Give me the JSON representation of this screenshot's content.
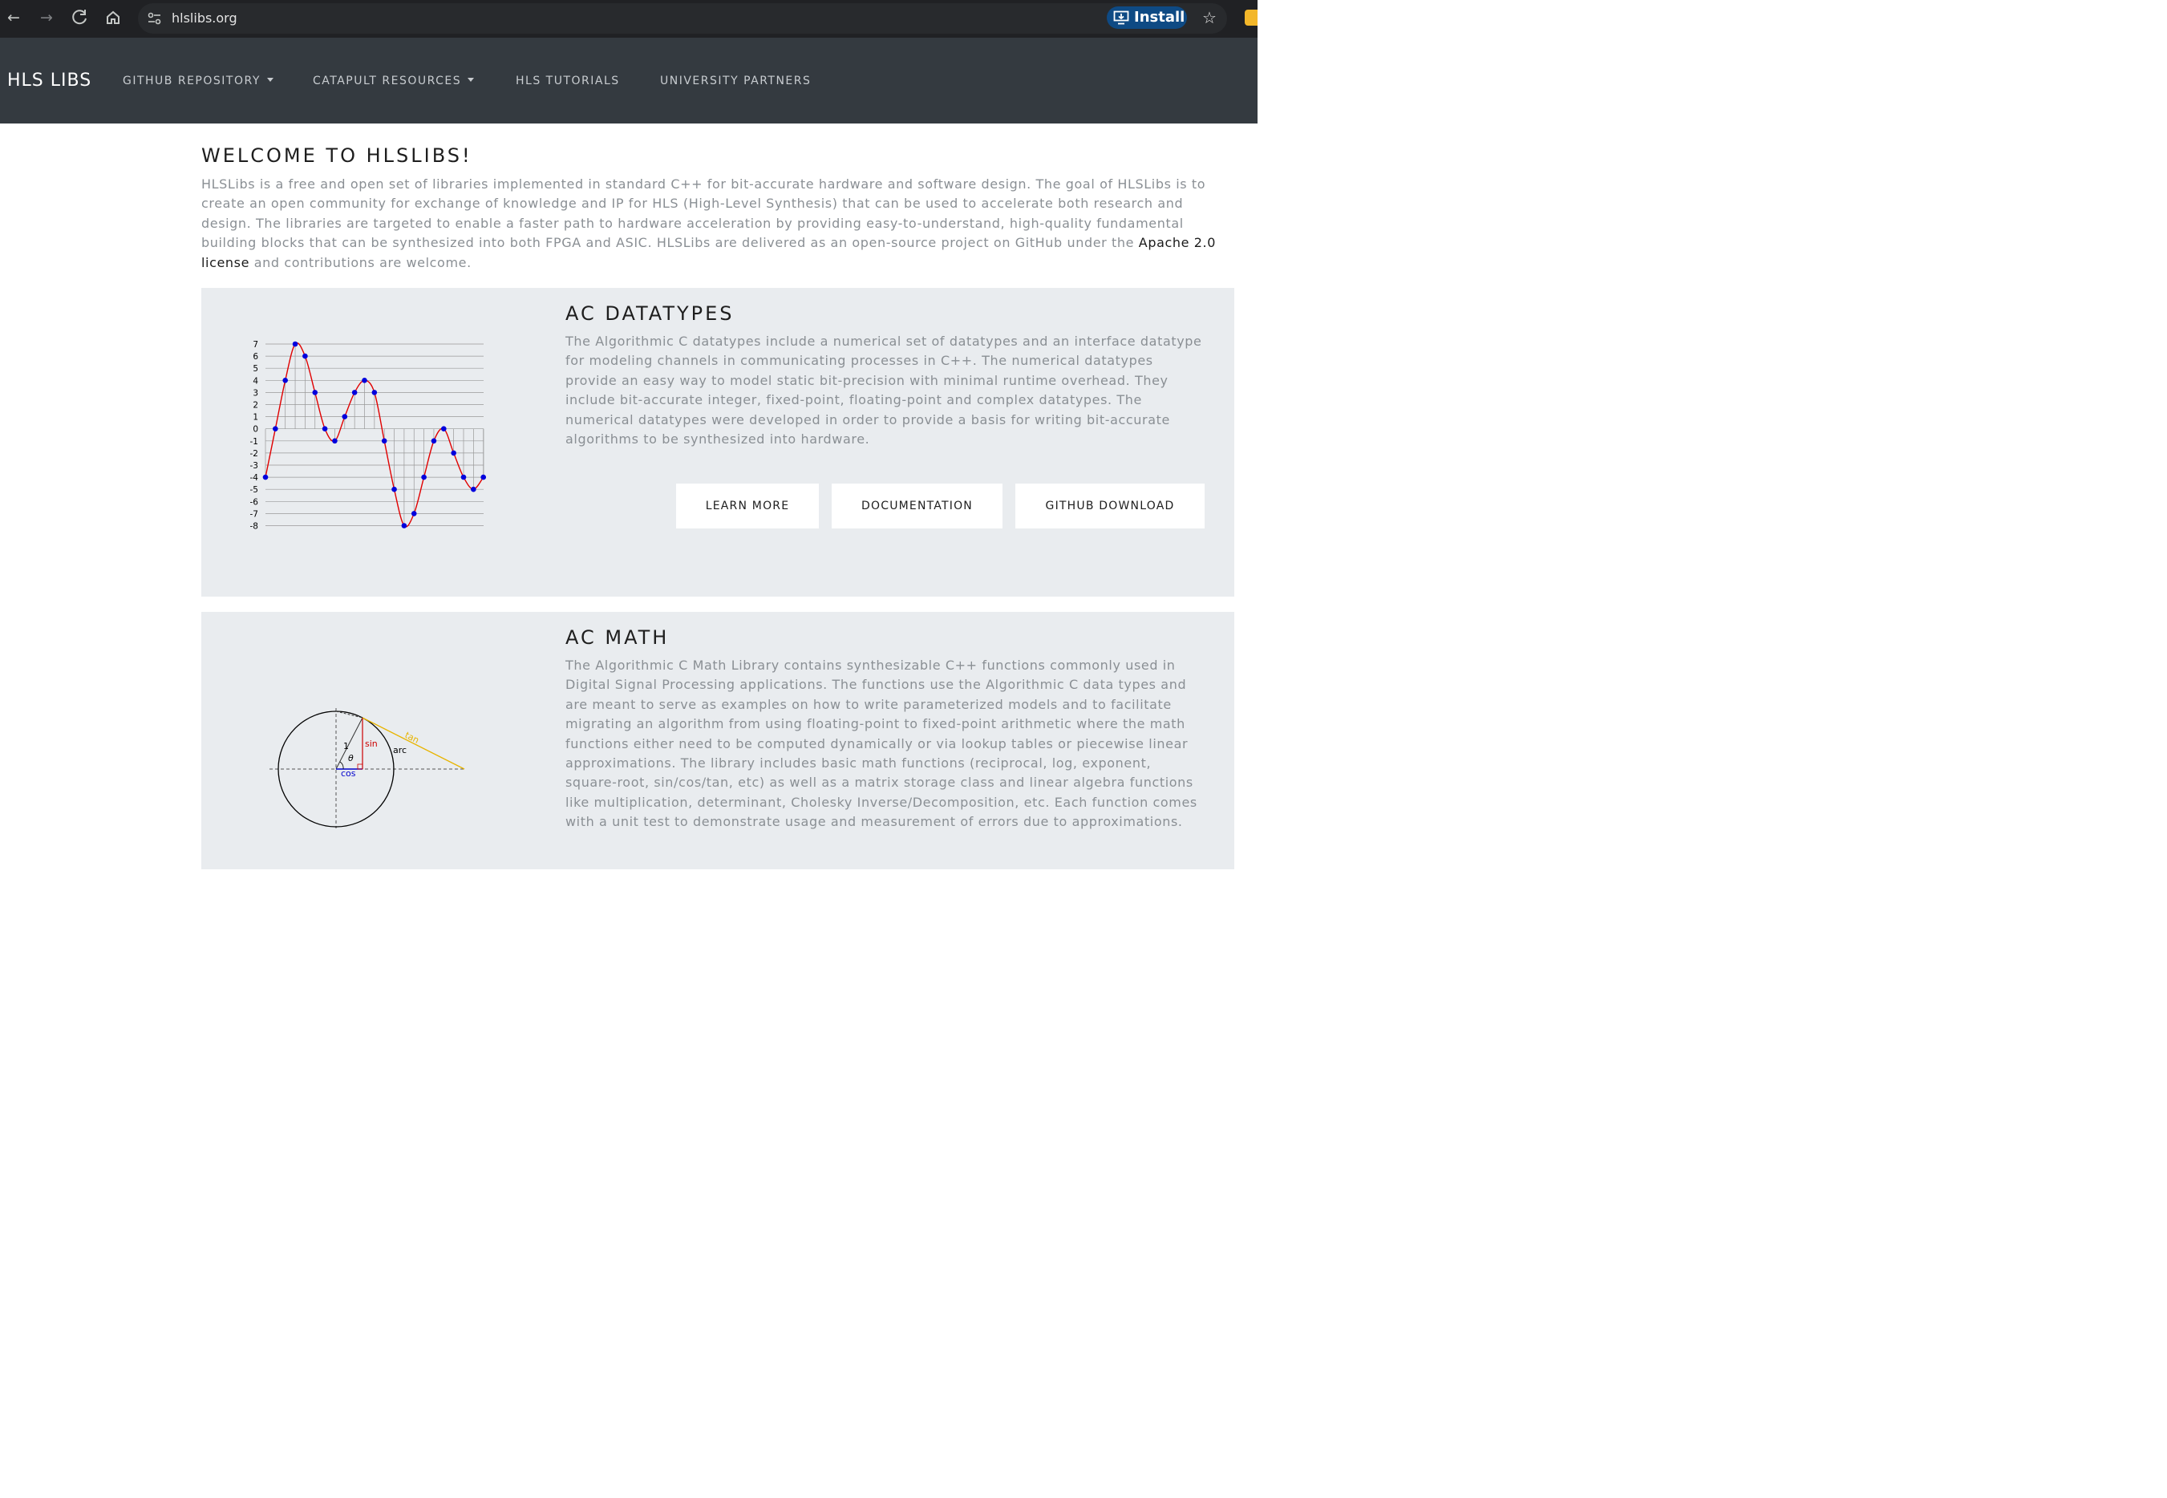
{
  "browser": {
    "url": "hlslibs.org",
    "install_label": "Install"
  },
  "site": {
    "brand": "HLS LIBS",
    "nav": [
      {
        "label": "GITHUB REPOSITORY",
        "dropdown": true
      },
      {
        "label": "CATAPULT RESOURCES",
        "dropdown": true
      },
      {
        "label": "HLS TUTORIALS",
        "dropdown": false
      },
      {
        "label": "UNIVERSITY PARTNERS",
        "dropdown": false
      }
    ]
  },
  "welcome": {
    "title": "WELCOME TO HLSLIBS!",
    "intro_before": "HLSLibs is a free and open set of libraries implemented in standard C++ for bit-accurate hardware and software design. The goal of HLSLibs is to create an open community for exchange of knowledge and IP for HLS (High-Level Synthesis) that can be used to accelerate both research and design. The libraries are targeted to enable a faster path to hardware acceleration by providing easy-to-understand, high-quality fundamental building blocks that can be synthesized into both FPGA and ASIC. HLSLibs are delivered as an open-source project on GitHub under the ",
    "intro_link": "Apache 2.0 license",
    "intro_after": " and contributions are welcome."
  },
  "cards": [
    {
      "title": "AC DATATYPES",
      "description": "The Algorithmic C datatypes include a numerical set of datatypes and an interface datatype for modeling channels in communicating processes in C++. The numerical datatypes provide an easy way to model static bit-precision with minimal runtime overhead. They include bit-accurate integer, fixed-point, floating-point and complex datatypes. The numerical datatypes were developed in order to provide a basis for writing bit-accurate algorithms to be synthesized into hardware.",
      "buttons": [
        "LEARN MORE",
        "DOCUMENTATION",
        "GITHUB DOWNLOAD"
      ]
    },
    {
      "title": "AC MATH",
      "description": "The Algorithmic C Math Library contains synthesizable C++ functions commonly used in Digital Signal Processing applications. The functions use the Algorithmic C data types and are meant to serve as examples on how to write parameterized models and to facilitate migrating an algorithm from using floating-point to fixed-point arithmetic where the math functions either need to be computed dynamically or via lookup tables or piecewise linear approximations. The library includes basic math functions (reciprocal, log, exponent, square-root, sin/cos/tan, etc) as well as a matrix storage class and linear algebra functions like multiplication, determinant, Cholesky Inverse/Decomposition, etc. Each function comes with a unit test to demonstrate usage and measurement of errors due to approximations."
    }
  ],
  "chart_data": {
    "type": "scatter",
    "y_ticks": [
      "7",
      "6",
      "5",
      "4",
      "3",
      "2",
      "1",
      "0",
      "-1",
      "-2",
      "-3",
      "-4",
      "-5",
      "-6",
      "-7",
      "-8"
    ],
    "ylim": [
      -8,
      7
    ],
    "x": [
      0,
      1,
      2,
      3,
      4,
      5,
      6,
      7,
      8,
      9,
      10,
      11,
      12,
      13,
      14,
      15,
      16,
      17,
      18,
      19,
      20,
      21,
      22,
      23
    ],
    "values": [
      -4,
      0,
      4,
      7,
      6,
      3,
      0,
      -1,
      1,
      3,
      4,
      3,
      -1,
      -5,
      -8,
      -7,
      -4,
      -1,
      0,
      -2,
      -4,
      -5,
      -4
    ],
    "colors": {
      "points": "#0000dd",
      "curve": "#e00000",
      "grid": "#999999"
    }
  },
  "trig_diagram": {
    "labels": {
      "one": "1",
      "sin": "sin",
      "cos": "cos",
      "theta": "θ",
      "arc": "arc",
      "tan": "tan"
    },
    "colors": {
      "sin": "#cc0000",
      "cos": "#0000cc",
      "tan": "#e8b400"
    }
  }
}
